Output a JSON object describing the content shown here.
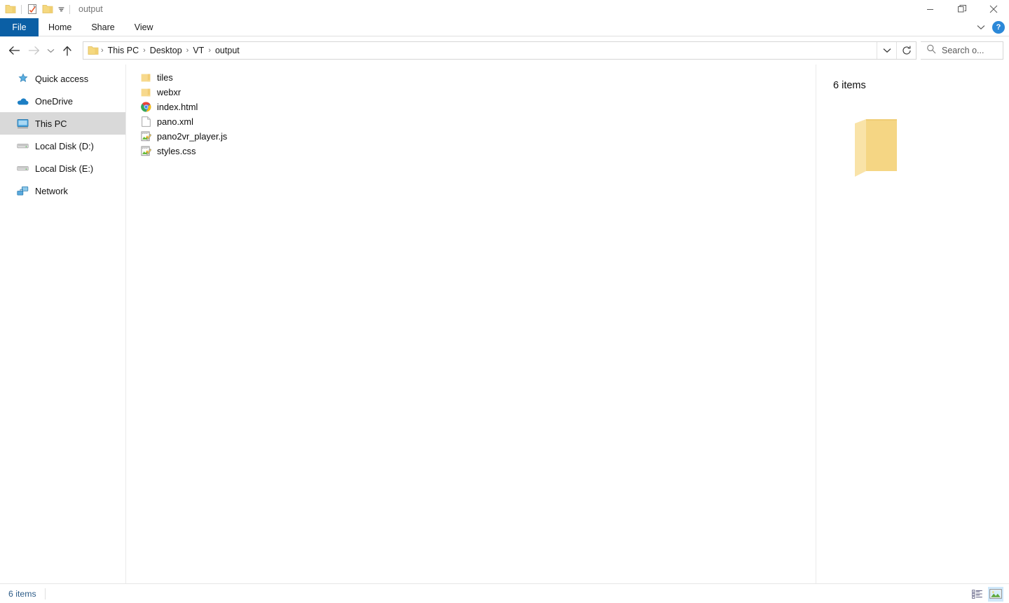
{
  "window": {
    "title": "output",
    "quick_access": [
      {
        "name": "folder-icon",
        "label": "Folder"
      },
      {
        "name": "properties-icon",
        "label": "Properties"
      },
      {
        "name": "new-folder-icon",
        "label": "New folder"
      }
    ],
    "quick_access_dropdown": "customize-quick-access-toolbar",
    "controls": {
      "minimize": "Minimize",
      "restore": "Restore Down",
      "close": "Close"
    }
  },
  "ribbon": {
    "tabs": [
      {
        "label": "File",
        "active": true
      },
      {
        "label": "Home",
        "active": false
      },
      {
        "label": "Share",
        "active": false
      },
      {
        "label": "View",
        "active": false
      }
    ],
    "expand_label": "Expand the Ribbon",
    "help_label": "?"
  },
  "addressbar": {
    "back_label": "Back",
    "forward_label": "Forward",
    "recent_label": "Recent locations",
    "up_label": "Up one level",
    "breadcrumbs": [
      "This PC",
      "Desktop",
      "VT",
      "output"
    ],
    "separator": "›",
    "dropdown_label": "Previous locations",
    "refresh_label": "Refresh"
  },
  "search": {
    "placeholder": "Search o...",
    "value": ""
  },
  "sidebar": {
    "items": [
      {
        "label": "Quick access",
        "icon": "star-icon",
        "selected": false
      },
      {
        "label": "OneDrive",
        "icon": "cloud-icon",
        "selected": false
      },
      {
        "label": "This PC",
        "icon": "monitor-icon",
        "selected": true
      },
      {
        "label": "Local Disk (D:)",
        "icon": "drive-icon",
        "selected": false
      },
      {
        "label": "Local Disk (E:)",
        "icon": "drive-icon",
        "selected": false
      },
      {
        "label": "Network",
        "icon": "network-icon",
        "selected": false
      }
    ]
  },
  "files": {
    "items": [
      {
        "name": "tiles",
        "icon": "folder-icon"
      },
      {
        "name": "webxr",
        "icon": "folder-icon"
      },
      {
        "name": "index.html",
        "icon": "chrome-icon"
      },
      {
        "name": "pano.xml",
        "icon": "blank-document-icon"
      },
      {
        "name": "pano2vr_player.js",
        "icon": "notepad-edit-icon"
      },
      {
        "name": "styles.css",
        "icon": "notepad-edit-icon"
      }
    ]
  },
  "details": {
    "count_label": "6 items",
    "thumbnail_icon": "open-folder-icon"
  },
  "statusbar": {
    "count_label": "6 items",
    "details_view_label": "Details view",
    "large_icons_view_label": "Large icons view",
    "active_view": "large_icons"
  },
  "colors": {
    "file_tab_blue": "#0b5fa5",
    "selection_gray": "#d9d9d9",
    "status_text_blue": "#2d5c88",
    "folder_yellow": "#f6d68a",
    "help_blue": "#2b88d8",
    "view_active_blue": "#cfe8fa"
  }
}
